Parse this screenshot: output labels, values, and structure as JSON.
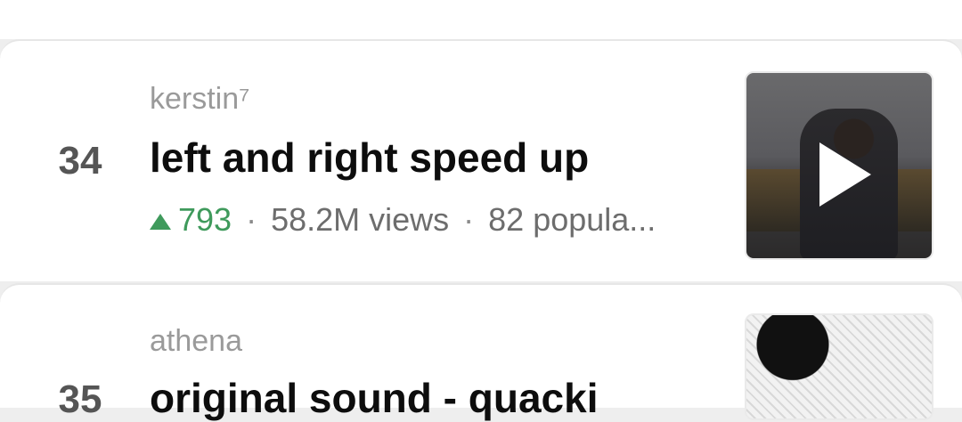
{
  "items": [
    {
      "rank": "34",
      "artist": "kerstin⁷",
      "title": "left and right speed up",
      "delta": "793",
      "views": "58.2M views",
      "popularity": "82 popula..."
    },
    {
      "rank": "35",
      "artist": "athena",
      "title": "original sound - quacki"
    }
  ],
  "icons": {
    "trend_up": "triangle-up-icon",
    "play": "play-icon"
  },
  "colors": {
    "trend_up": "#3f9a5c",
    "title": "#0d0d0d",
    "artist": "#9a9a9a"
  }
}
